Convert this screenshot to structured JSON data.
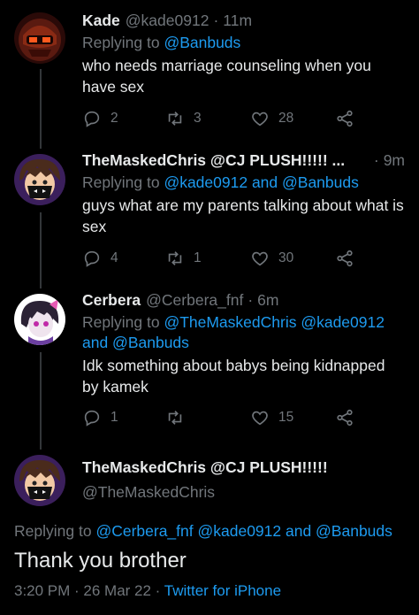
{
  "tweets": [
    {
      "name": "Kade",
      "handle": "@kade0912",
      "dot": "·",
      "time": "11m",
      "replying_prefix": "Replying to",
      "replying_to": "@Banbuds",
      "text": "who needs marriage counseling when you have sex",
      "replies": "2",
      "retweets": "3",
      "likes": "28"
    },
    {
      "name": "TheMaskedChris @CJ PLUSH!!!!! ...",
      "handle": "",
      "dot": "·",
      "time": "9m",
      "replying_prefix": "Replying to",
      "replying_to": "@kade0912 and @Banbuds",
      "text": "guys what are my parents talking about what is sex",
      "replies": "4",
      "retweets": "1",
      "likes": "30"
    },
    {
      "name": "Cerbera",
      "handle": "@Cerbera_fnf",
      "dot": "·",
      "time": "6m",
      "replying_prefix": "Replying to",
      "replying_to": "@TheMaskedChris @kade0912 and @Banbuds",
      "text": "Idk something about babys being kidnapped by kamek",
      "replies": "1",
      "retweets": "",
      "likes": "15"
    }
  ],
  "main_tweet": {
    "name": "TheMaskedChris @CJ PLUSH!!!!!",
    "handle": "@TheMaskedChris",
    "replying_prefix": "Replying to",
    "replying_to": "@Cerbera_fnf @kade0912 and @Banbuds",
    "text": "Thank you brother",
    "timestamp": "3:20 PM · 26 Mar 22 ·",
    "source": "Twitter for iPhone"
  },
  "colors": {
    "background": "#000000",
    "text": "#e7e9ea",
    "muted": "#71767b",
    "link": "#1d9bf0"
  },
  "icons": [
    "reply-icon",
    "retweet-icon",
    "like-icon",
    "share-icon"
  ]
}
